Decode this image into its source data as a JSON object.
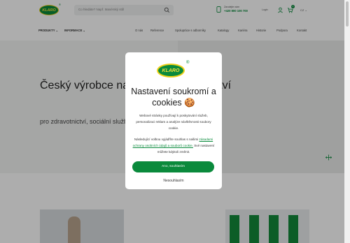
{
  "header": {
    "logo_text": "KLARO",
    "logo_reg": "®",
    "search_placeholder": "Co hledáte? Např. Masérský stůl",
    "phone_label": "Zavolejte nám",
    "phone_number": "+420 800 100 700",
    "login_label": "Login",
    "cart_count": "0",
    "lang": "CZ ⌄"
  },
  "nav": {
    "produkty": "PRODUKTY ⌄",
    "informace": "INFORMACE ⌄",
    "items": [
      "O nás",
      "Reference",
      "Spolupráce s odborníky",
      "Katalogy",
      "Kariéra",
      "Historie",
      "Podpora",
      "Kontakt"
    ]
  },
  "hero": {
    "title": "Český výrobce nábytku a příslušenství",
    "subtitle": "pro zdravotnictví, sociální služby a další obory"
  },
  "modal": {
    "logo_text": "KLARO",
    "logo_reg": "®",
    "title": "Nastavení soukromí a cookies 🍪",
    "p1": "Webové stránky používají k poskytování služeb, personalizaci reklam a analýze návštěvnosti soubory cookie.",
    "p2_before": "Následující volbou vyjádříte souhlas s našimi",
    "p2_link": "zásadami ochrany osobních údajů a souborů cookie.",
    "p2_after": "Své nastavení můžete kdykoli změnit.",
    "accept_label": "Ano, souhlasím",
    "reject_label": "Nesouhlasím"
  },
  "colors": {
    "brand_green": "#0a8a3c",
    "brand_yellow": "#f1d21a"
  }
}
